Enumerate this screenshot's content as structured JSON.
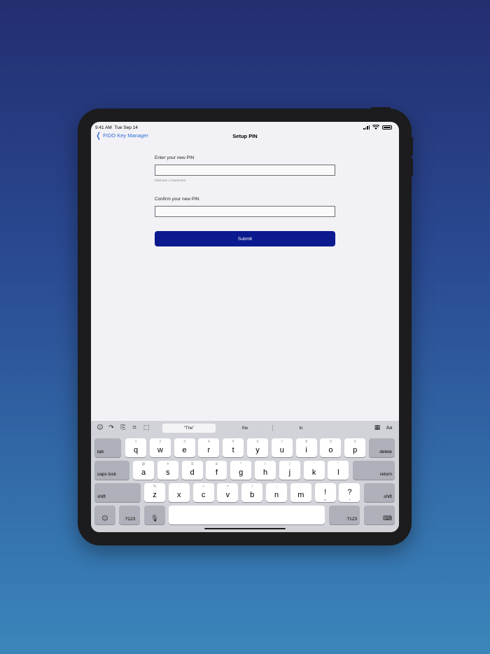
{
  "status": {
    "time": "9:41 AM",
    "date": "Tue Sep 14",
    "icons": [
      "signal-icon",
      "wifi-icon",
      "battery-icon"
    ]
  },
  "nav": {
    "back_label": "FIDO Key Manager",
    "title": "Setup PIN"
  },
  "form": {
    "new_pin_label": "Enter your new PIN",
    "new_pin_value": "",
    "new_pin_hint": "Minimum 4 characters",
    "confirm_pin_label": "Confirm your new PIN",
    "confirm_pin_value": "",
    "submit_label": "Submit"
  },
  "keyboard": {
    "suggestions": [
      "“The”",
      "the",
      "to"
    ],
    "toolbar_right": "Aa",
    "tab": "tab",
    "delete": "delete",
    "caps_lock": "caps lock",
    "return": "return",
    "shift_left": "shift",
    "shift_right": "shift",
    "numbers_left": ".?123",
    "numbers_right": ".?123",
    "row1": [
      {
        "main": "q",
        "alt": "1"
      },
      {
        "main": "w",
        "alt": "2"
      },
      {
        "main": "e",
        "alt": "3"
      },
      {
        "main": "r",
        "alt": "4"
      },
      {
        "main": "t",
        "alt": "5"
      },
      {
        "main": "y",
        "alt": "6"
      },
      {
        "main": "u",
        "alt": "7"
      },
      {
        "main": "i",
        "alt": "8"
      },
      {
        "main": "o",
        "alt": "9"
      },
      {
        "main": "p",
        "alt": "0"
      }
    ],
    "row2": [
      {
        "main": "a",
        "alt": "@"
      },
      {
        "main": "s",
        "alt": "#"
      },
      {
        "main": "d",
        "alt": "$"
      },
      {
        "main": "f",
        "alt": "&"
      },
      {
        "main": "g",
        "alt": "*"
      },
      {
        "main": "h",
        "alt": "("
      },
      {
        "main": "j",
        "alt": ")"
      },
      {
        "main": "k",
        "alt": "'"
      },
      {
        "main": "l",
        "alt": "\""
      }
    ],
    "row3": [
      {
        "main": "z",
        "alt": "%"
      },
      {
        "main": "x",
        "alt": "-"
      },
      {
        "main": "c",
        "alt": "+"
      },
      {
        "main": "v",
        "alt": "="
      },
      {
        "main": "b",
        "alt": "/"
      },
      {
        "main": "n",
        "alt": ";"
      },
      {
        "main": "m",
        "alt": ":"
      },
      {
        "main": "!",
        "alt": ""
      },
      {
        "main": "?",
        "alt": ""
      }
    ],
    "row3_sub": {
      "!": ",",
      "?": "."
    }
  }
}
